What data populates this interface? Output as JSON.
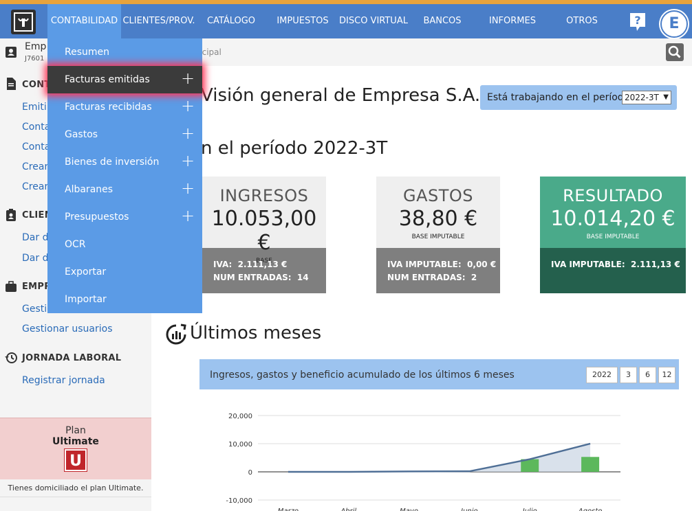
{
  "nav": {
    "items": [
      {
        "label": "CONTABILIDAD",
        "active": true
      },
      {
        "label": "CLIENTES/PROV."
      },
      {
        "label": "CATÁLOGO"
      },
      {
        "label": "IMPUESTOS"
      },
      {
        "label": "DISCO VIRTUAL"
      },
      {
        "label": "BANCOS"
      },
      {
        "label": "INFORMES"
      },
      {
        "label": "OTROS"
      }
    ],
    "help": "?",
    "avatar": "E",
    "accent": "#e8a33c",
    "bar_color": "#4a7ec8"
  },
  "sidebar": {
    "company_name": "Emp",
    "company_id": "J7601",
    "sections": [
      {
        "title": "CONT",
        "icon": "document-icon",
        "links": [
          "Emitir",
          "Conta",
          "Conta",
          "Crear",
          "Crear"
        ]
      },
      {
        "title": "CLIEN",
        "icon": "badge-icon",
        "links": [
          "Dar d",
          "Dar d"
        ]
      },
      {
        "title": "EMPR",
        "icon": "briefcase-icon",
        "links": [
          "Gestio",
          "Gestionar usuarios"
        ]
      },
      {
        "title": "JORNADA LABORAL",
        "icon": "history-icon",
        "links": [
          "Registrar jornada"
        ]
      }
    ],
    "plan_label": "Plan",
    "plan_name": "Ultimate",
    "plan_badge": "U",
    "plan_note": "Tienes domiciliado el plan Ultimate."
  },
  "breadcrumb": "ncipal",
  "main": {
    "title": "Visión general de Empresa S.A.",
    "period_text": "Está trabajando en el período",
    "period_value": "2022-3T",
    "period_heading": "n el período 2022-3T",
    "cards": [
      {
        "label": "INGRESOS",
        "amount": "10.053,00 €",
        "sub": "BASE",
        "lines": [
          {
            "k": "IVA:",
            "v": "2.111,13 €"
          },
          {
            "k": "NUM ENTRADAS:",
            "v": "14"
          }
        ]
      },
      {
        "label": "GASTOS",
        "amount": "38,80 €",
        "sub": "BASE IMPUTABLE",
        "lines": [
          {
            "k": "IVA IMPUTABLE:",
            "v": "0,00 €"
          },
          {
            "k": "NUM ENTRADAS:",
            "v": "2"
          }
        ]
      },
      {
        "label": "RESULTADO",
        "amount": "10.014,20 €",
        "sub": "BASE IMPUTABLE",
        "lines": [
          {
            "k": "IVA IMPUTABLE:",
            "v": "2.111,13 €"
          }
        ]
      }
    ],
    "months_title": "Últimos meses"
  },
  "chart_panel": {
    "title": "Ingresos, gastos y beneficio acumulado de los últimos 6 meses",
    "ranges": [
      "2022",
      "3",
      "6",
      "12"
    ]
  },
  "chart_data": {
    "type": "bar",
    "categories": [
      "Marzo",
      "Abril",
      "Mayo",
      "Junio",
      "Julio",
      "Agosto"
    ],
    "yticks": [
      "20,000",
      "10,000",
      "0",
      "-10,000"
    ],
    "ylim": [
      -10000,
      20000
    ],
    "series": [
      {
        "kind": "bar",
        "values": [
          0,
          0,
          0,
          0,
          4500,
          5300
        ],
        "color": "#5cb85c"
      },
      {
        "kind": "line",
        "values": [
          0,
          0,
          150,
          200,
          4500,
          10014
        ],
        "color": "#4f6f96"
      }
    ]
  },
  "dropdown": {
    "items": [
      {
        "label": "Resumen",
        "plus": false
      },
      {
        "label": "Facturas emitidas",
        "plus": true,
        "highlight": true
      },
      {
        "label": "Facturas recibidas",
        "plus": true
      },
      {
        "label": "Gastos",
        "plus": true
      },
      {
        "label": "Bienes de inversión",
        "plus": true
      },
      {
        "label": "Albaranes",
        "plus": true
      },
      {
        "label": "Presupuestos",
        "plus": true
      },
      {
        "label": "OCR",
        "plus": false
      },
      {
        "label": "Exportar",
        "plus": false
      },
      {
        "label": "Importar",
        "plus": false
      }
    ],
    "plus_symbol": "+"
  }
}
